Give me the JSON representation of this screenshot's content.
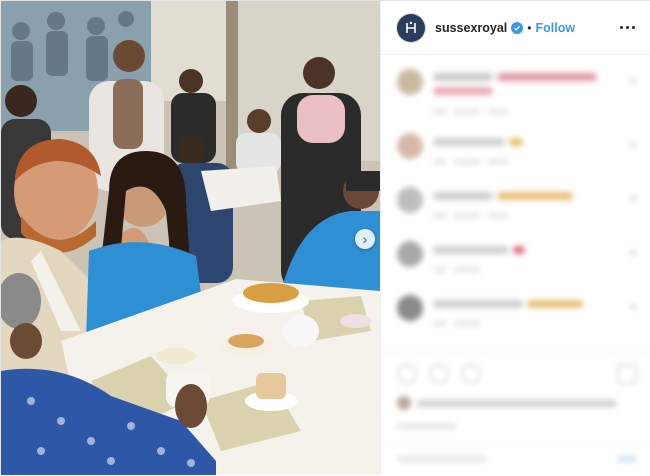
{
  "post": {
    "username": "sussexroyal",
    "verified": true,
    "separator": "•",
    "follow_label": "Follow",
    "menu_icon": "more-options-icon",
    "carousel_icon": "chevron-right-icon"
  },
  "colors": {
    "link_blue": "#3897f0",
    "text": "#262626",
    "avatar_bg": "#2b3d5c"
  }
}
